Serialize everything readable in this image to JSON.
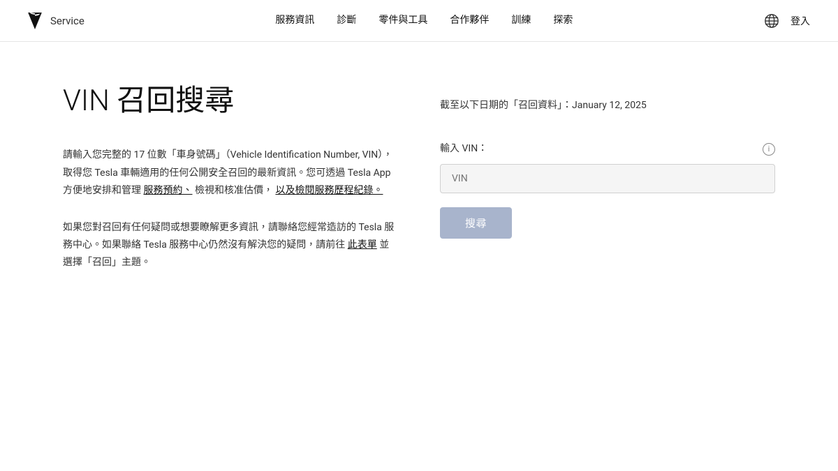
{
  "header": {
    "brand": "TESLA",
    "service_label": "Service",
    "nav_items": [
      {
        "label": "服務資訊",
        "id": "service-info"
      },
      {
        "label": "診斷",
        "id": "diagnostics"
      },
      {
        "label": "零件與工具",
        "id": "parts-tools"
      },
      {
        "label": "合作夥伴",
        "id": "partners"
      },
      {
        "label": "訓練",
        "id": "training"
      },
      {
        "label": "探索",
        "id": "explore"
      }
    ],
    "login_label": "登入",
    "globe_label": "語言選擇"
  },
  "main": {
    "page_title": "VIN 召回搜尋",
    "description_1": "請輸入您完整的 17 位數「車身號碼」（Vehicle Identification Number, VIN），取得您 Tesla 車輛適用的任何公開安全召回的最新資訊。您可透過 Tesla App 方便地安排和管理",
    "link_1": "服務預約、",
    "desc_mid": "檢視和核准估價，",
    "link_2": "以及檢閱服務歷程紀錄。",
    "description_2_pre": "如果您對召回有任何疑問或想要瞭解更多資訊，請聯絡您經常造訪的 Tesla 服務中心。如果聯絡 Tesla 服務中心仍然沒有解決您的疑問，請前往",
    "link_3": "此表單",
    "description_2_post": "並選擇「召回」主題。",
    "recall_date_label": "截至以下日期的「召回資料」：January 12, 2025",
    "vin_input_label": "輸入 VIN：",
    "vin_placeholder": "VIN",
    "search_button_label": "搜尋"
  }
}
